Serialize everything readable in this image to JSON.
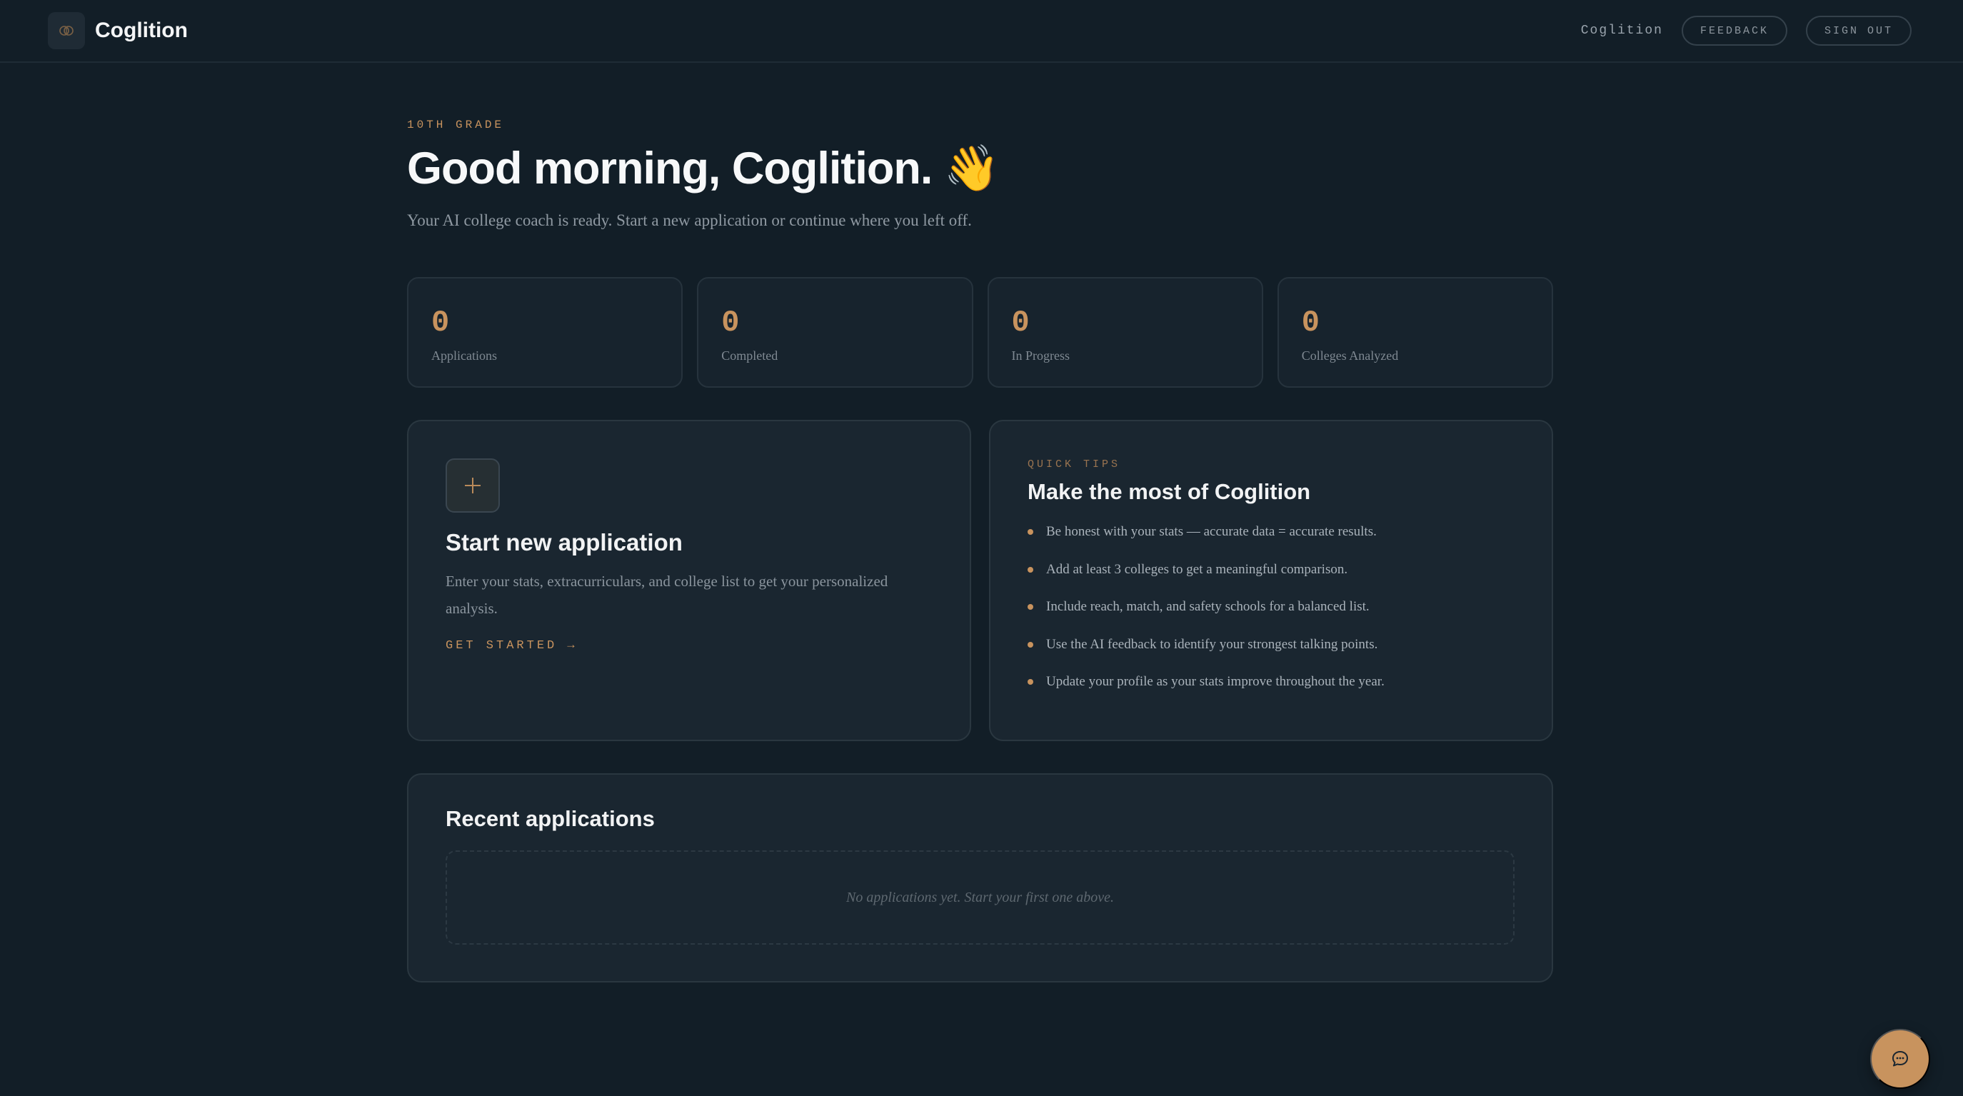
{
  "header": {
    "brand": "Coglition",
    "user": "Coglition",
    "feedback_label": "FEEDBACK",
    "signout_label": "SIGN OUT"
  },
  "hero": {
    "grade": "10TH GRADE",
    "greeting": "Good morning, Coglition. 👋",
    "subtitle": "Your AI college coach is ready. Start a new application or continue where you left off."
  },
  "stats": [
    {
      "value": "0",
      "label": "Applications"
    },
    {
      "value": "0",
      "label": "Completed"
    },
    {
      "value": "0",
      "label": "In Progress"
    },
    {
      "value": "0",
      "label": "Colleges Analyzed"
    }
  ],
  "new_application": {
    "title": "Start new application",
    "description": "Enter your stats, extracurriculars, and college list to get your personalized analysis.",
    "cta": "GET STARTED →"
  },
  "quick_tips": {
    "eyebrow": "QUICK TIPS",
    "title": "Make the most of Coglition",
    "items": [
      "Be honest with your stats — accurate data = accurate results.",
      "Add at least 3 colleges to get a meaningful comparison.",
      "Include reach, match, and safety schools for a balanced list.",
      "Use the AI feedback to identify your strongest talking points.",
      "Update your profile as your stats improve throughout the year."
    ]
  },
  "recent": {
    "title": "Recent applications",
    "empty_message": "No applications yet. Start your first one above."
  },
  "icons": {
    "logo": "brain-icon",
    "new": "plus-icon",
    "chat": "chat-bubble-icon"
  },
  "colors": {
    "accent": "#c8935e",
    "background": "#121e27",
    "card": "#1a2630"
  }
}
